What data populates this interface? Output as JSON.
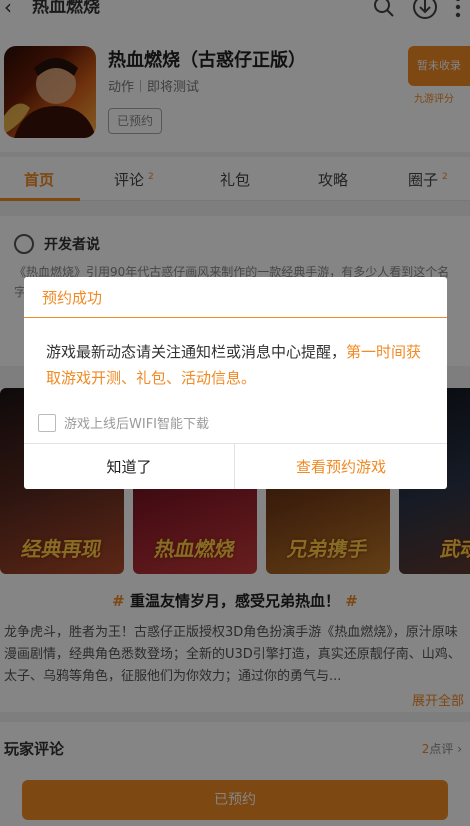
{
  "topbar": {
    "back_glyph": "‹",
    "title": "热血燃烧"
  },
  "game": {
    "name": "热血燃烧（古惑仔正版）",
    "genre": "动作",
    "status": "即将测试",
    "reserved_badge": "已预约",
    "rating_box": "暂未收录",
    "rating_source": "九游评分"
  },
  "tabs": [
    {
      "label": "首页",
      "count": ""
    },
    {
      "label": "评论",
      "count": "2"
    },
    {
      "label": "礼包",
      "count": ""
    },
    {
      "label": "攻略",
      "count": ""
    },
    {
      "label": "圈子",
      "count": "2"
    }
  ],
  "dev": {
    "title": "开发者说",
    "text": "《热血燃烧》引用90年代古惑仔画风来制作的一款经典手游，有多少人看到这个名字"
  },
  "screenshots": [
    {
      "caption": "经典再现"
    },
    {
      "caption": "热血燃烧"
    },
    {
      "caption": "兄弟携手"
    },
    {
      "caption": "武魂"
    }
  ],
  "intro": {
    "hash": "#",
    "headline": "重温友情岁月，感受兄弟热血！",
    "text": "龙争虎斗，胜者为王！古惑仔正版授权3D角色扮演手游《热血燃烧》，原汁原味漫画剧情，经典角色悉数登场；全新的U3D引擎打造，真实还原靓仔南、山鸡、太子、乌鸦等角色，征服他们为你效力；通过你的勇气与...",
    "expand_label": "展开全部"
  },
  "comments": {
    "title": "玩家评论",
    "count": "2",
    "count_suffix": "点评 ›"
  },
  "bottom": {
    "button_label": "已预约"
  },
  "dialog": {
    "title": "预约成功",
    "message_plain": "游戏最新动态请关注通知栏或消息中心提醒，",
    "message_highlight": "第一时间获取游戏开测、礼包、活动信息。",
    "checkbox_label": "游戏上线后WIFI智能下载",
    "checkbox_checked": false,
    "button_ok": "知道了",
    "button_view": "查看预约游戏"
  },
  "colors": {
    "accent": "#f08a24",
    "overlay": "rgba(0,0,0,0.48)"
  },
  "icons": [
    "back-arrow-icon",
    "search-icon",
    "download-icon",
    "more-icon",
    "developer-icon"
  ]
}
